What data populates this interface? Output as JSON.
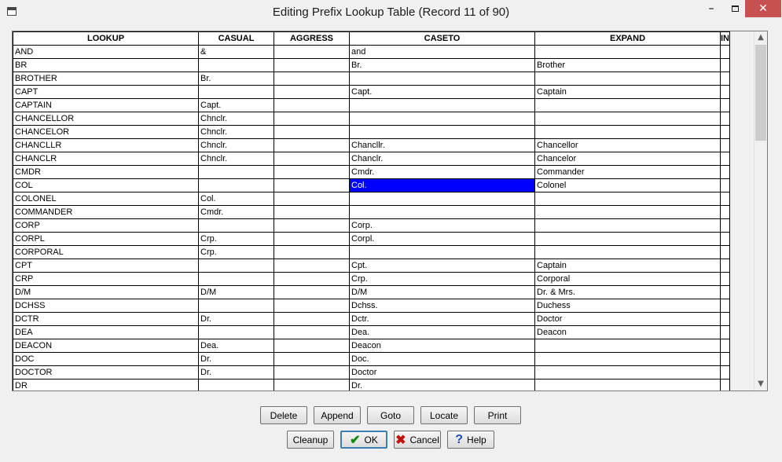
{
  "window": {
    "title": "Editing Prefix Lookup Table (Record 11 of 90)",
    "min_glyph": "–",
    "close_glyph": "✕"
  },
  "grid": {
    "columns": [
      "LOOKUP",
      "CASUAL",
      "AGGRESS",
      "CASETO",
      "EXPAND",
      "IN"
    ],
    "selected_row": 10,
    "selected_col": 3,
    "rows": [
      [
        "AND",
        "&",
        "",
        "and",
        ""
      ],
      [
        "BR",
        "",
        "",
        "Br.",
        "Brother"
      ],
      [
        "BROTHER",
        "Br.",
        "",
        "",
        ""
      ],
      [
        "CAPT",
        "",
        "",
        "Capt.",
        "Captain"
      ],
      [
        "CAPTAIN",
        "Capt.",
        "",
        "",
        ""
      ],
      [
        "CHANCELLOR",
        "Chnclr.",
        "",
        "",
        ""
      ],
      [
        "CHANCELOR",
        "Chnclr.",
        "",
        "",
        ""
      ],
      [
        "CHANCLLR",
        "Chnclr.",
        "",
        "Chancllr.",
        "Chancellor"
      ],
      [
        "CHANCLR",
        "Chnclr.",
        "",
        "Chanclr.",
        "Chancelor"
      ],
      [
        "CMDR",
        "",
        "",
        "Cmdr.",
        "Commander"
      ],
      [
        "COL",
        "",
        "",
        "Col.",
        "Colonel"
      ],
      [
        "COLONEL",
        "Col.",
        "",
        "",
        ""
      ],
      [
        "COMMANDER",
        "Cmdr.",
        "",
        "",
        ""
      ],
      [
        "CORP",
        "",
        "",
        "Corp.",
        ""
      ],
      [
        "CORPL",
        "Crp.",
        "",
        "Corpl.",
        ""
      ],
      [
        "CORPORAL",
        "Crp.",
        "",
        "",
        ""
      ],
      [
        "CPT",
        "",
        "",
        "Cpt.",
        "Captain"
      ],
      [
        "CRP",
        "",
        "",
        "Crp.",
        "Corporal"
      ],
      [
        "D/M",
        "D/M",
        "",
        "D/M",
        "Dr. & Mrs."
      ],
      [
        "DCHSS",
        "",
        "",
        "Dchss.",
        "Duchess"
      ],
      [
        "DCTR",
        "Dr.",
        "",
        "Dctr.",
        "Doctor"
      ],
      [
        "DEA",
        "",
        "",
        "Dea.",
        "Deacon"
      ],
      [
        "DEACON",
        "Dea.",
        "",
        "Deacon",
        ""
      ],
      [
        "DOC",
        "Dr.",
        "",
        "Doc.",
        ""
      ],
      [
        "DOCTOR",
        "Dr.",
        "",
        "Doctor",
        ""
      ],
      [
        "DR",
        "",
        "",
        "Dr.",
        ""
      ]
    ]
  },
  "buttons": {
    "delete": "Delete",
    "append": "Append",
    "goto": "Goto",
    "locate": "Locate",
    "print": "Print",
    "cleanup": "Cleanup",
    "ok": "OK",
    "cancel": "Cancel",
    "help": "Help"
  },
  "icons": {
    "ok": "checkmark-icon",
    "cancel": "x-icon",
    "help": "question-icon"
  }
}
